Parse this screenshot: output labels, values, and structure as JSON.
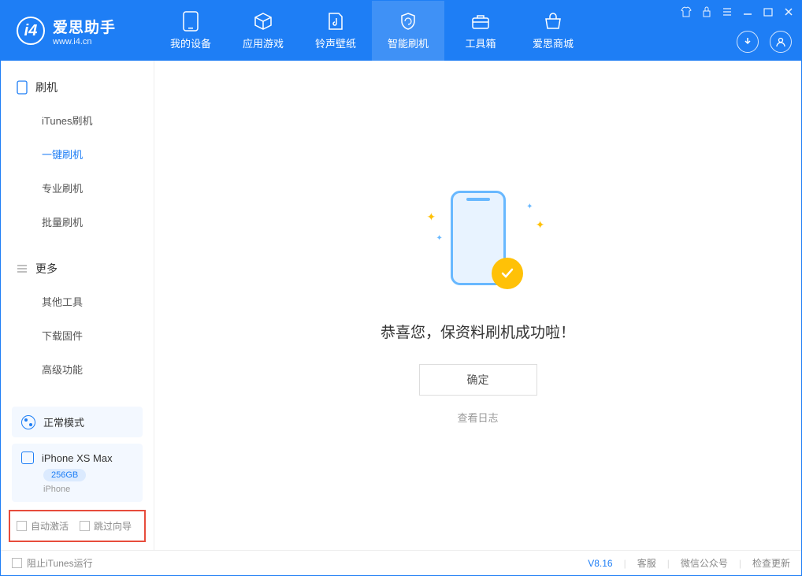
{
  "app": {
    "title": "爱思助手",
    "url": "www.i4.cn"
  },
  "tabs": {
    "device": "我的设备",
    "apps": "应用游戏",
    "ringtones": "铃声壁纸",
    "flash": "智能刷机",
    "toolbox": "工具箱",
    "store": "爱思商城"
  },
  "sidebar": {
    "section1": {
      "title": "刷机",
      "items": [
        "iTunes刷机",
        "一键刷机",
        "专业刷机",
        "批量刷机"
      ]
    },
    "section2": {
      "title": "更多",
      "items": [
        "其他工具",
        "下载固件",
        "高级功能"
      ]
    },
    "mode": "正常模式",
    "device": {
      "name": "iPhone XS Max",
      "capacity": "256GB",
      "type": "iPhone"
    },
    "checkboxes": {
      "auto_activate": "自动激活",
      "skip_guide": "跳过向导"
    }
  },
  "main": {
    "message": "恭喜您，保资料刷机成功啦！",
    "confirm": "确定",
    "view_log": "查看日志"
  },
  "footer": {
    "block_itunes": "阻止iTunes运行",
    "version": "V8.16",
    "support": "客服",
    "wechat": "微信公众号",
    "update": "检查更新"
  }
}
